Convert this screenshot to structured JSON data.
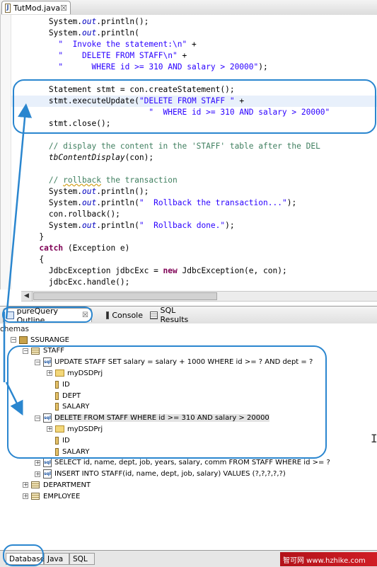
{
  "editor": {
    "tab_label": "TutMod.java",
    "tab_icon": "java-file-icon",
    "close_glyph": "☒"
  },
  "code": [
    {
      "segs": [
        [
          "",
          "        System."
        ],
        [
          "fld",
          "out"
        ],
        [
          "",
          ".println();"
        ]
      ]
    },
    {
      "segs": [
        [
          "",
          "        System."
        ],
        [
          "fld",
          "out"
        ],
        [
          "",
          ".println("
        ]
      ]
    },
    {
      "segs": [
        [
          "",
          "          "
        ],
        [
          "str",
          "\"  Invoke the statement:\\n\""
        ],
        [
          "",
          " +"
        ]
      ]
    },
    {
      "segs": [
        [
          "",
          "          "
        ],
        [
          "str",
          "\"    DELETE FROM STAFF\\n\""
        ],
        [
          "",
          " +"
        ]
      ]
    },
    {
      "segs": [
        [
          "",
          "          "
        ],
        [
          "str",
          "\"      WHERE id >= 310 AND salary > 20000\""
        ],
        [
          "",
          ");"
        ]
      ]
    },
    {
      "segs": [
        [
          "",
          ""
        ]
      ]
    },
    {
      "segs": [
        [
          "",
          "        Statement stmt = con.createStatement();"
        ]
      ]
    },
    {
      "segs": [
        [
          "",
          "        stmt.executeUpdate("
        ],
        [
          "str",
          "\"DELETE FROM STAFF \""
        ],
        [
          "",
          " +"
        ]
      ]
    },
    {
      "segs": [
        [
          "",
          "                             "
        ],
        [
          "str",
          "\"  WHERE id >= 310 AND salary > 20000\""
        ]
      ]
    },
    {
      "segs": [
        [
          "",
          "        stmt.close();"
        ]
      ]
    },
    {
      "segs": [
        [
          "",
          ""
        ]
      ]
    },
    {
      "segs": [
        [
          "cmt",
          "        // display the content in the 'STAFF' table after the DEL"
        ]
      ]
    },
    {
      "segs": [
        [
          "",
          "        "
        ],
        [
          "mth",
          "tbContentDisplay"
        ],
        [
          "",
          "(con);"
        ]
      ]
    },
    {
      "segs": [
        [
          "",
          ""
        ]
      ]
    },
    {
      "segs": [
        [
          "cmt",
          "        // "
        ],
        [
          "cmtsq",
          "rollback"
        ],
        [
          "cmt",
          " the transaction"
        ]
      ]
    },
    {
      "segs": [
        [
          "",
          "        System."
        ],
        [
          "fld",
          "out"
        ],
        [
          "",
          ".println();"
        ]
      ]
    },
    {
      "segs": [
        [
          "",
          "        System."
        ],
        [
          "fld",
          "out"
        ],
        [
          "",
          ".println("
        ],
        [
          "str",
          "\"  Rollback the transaction...\""
        ],
        [
          "",
          ");"
        ]
      ]
    },
    {
      "segs": [
        [
          "",
          "        con.rollback();"
        ]
      ]
    },
    {
      "segs": [
        [
          "",
          "        System."
        ],
        [
          "fld",
          "out"
        ],
        [
          "",
          ".println("
        ],
        [
          "str",
          "\"  Rollback done.\""
        ],
        [
          "",
          ");"
        ]
      ]
    },
    {
      "segs": [
        [
          "",
          "      }"
        ]
      ]
    },
    {
      "segs": [
        [
          "",
          "      "
        ],
        [
          "kw",
          "catch"
        ],
        [
          "",
          " (Exception e)"
        ]
      ]
    },
    {
      "segs": [
        [
          "",
          "      {"
        ]
      ]
    },
    {
      "segs": [
        [
          "",
          "        JdbcException jdbcExc = "
        ],
        [
          "kw",
          "new"
        ],
        [
          "",
          " JdbcException(e, con);"
        ]
      ]
    },
    {
      "segs": [
        [
          "",
          "        jdbcExc.handle();"
        ]
      ]
    },
    {
      "segs": [
        [
          "",
          "      }"
        ]
      ]
    }
  ],
  "views": {
    "tabs": [
      {
        "label": "pureQuery Outline",
        "icon": "outline-icon",
        "active": true,
        "close": "☒"
      },
      {
        "label": "Console",
        "icon": "console-icon",
        "active": false
      },
      {
        "label": "SQL Results",
        "icon": "sql-results-icon",
        "active": false
      }
    ]
  },
  "outline": {
    "header": "chemas",
    "rows": [
      {
        "label": "SSURANGE",
        "depth": 0,
        "exp": "−",
        "icon": "schema"
      },
      {
        "label": "STAFF",
        "depth": 1,
        "exp": "−",
        "icon": "table"
      },
      {
        "label": "UPDATE STAFF   SET salary = salary + 1000   WHERE id >= ? AND dept = ?",
        "depth": 2,
        "exp": "−",
        "icon": "sql"
      },
      {
        "label": "myDSDPrj",
        "depth": 3,
        "exp": "+",
        "icon": "folder"
      },
      {
        "label": "ID",
        "depth": 3,
        "exp": "",
        "icon": "column"
      },
      {
        "label": "DEPT",
        "depth": 3,
        "exp": "",
        "icon": "column"
      },
      {
        "label": "SALARY",
        "depth": 3,
        "exp": "",
        "icon": "column"
      },
      {
        "label": "DELETE FROM STAFF   WHERE id >= 310 AND salary > 20000",
        "depth": 2,
        "exp": "−",
        "icon": "sql",
        "selected": true
      },
      {
        "label": "myDSDPrj",
        "depth": 3,
        "exp": "+",
        "icon": "folder"
      },
      {
        "label": "ID",
        "depth": 3,
        "exp": "",
        "icon": "column"
      },
      {
        "label": "SALARY",
        "depth": 3,
        "exp": "",
        "icon": "column"
      },
      {
        "label": "SELECT id, name, dept, job, years, salary, comm   FROM STAFF   WHERE id >= ?",
        "depth": 2,
        "exp": "+",
        "icon": "sql"
      },
      {
        "label": "INSERT INTO STAFF(id, name, dept, job, salary)   VALUES (?,?,?,?,?)",
        "depth": 2,
        "exp": "+",
        "icon": "sql"
      },
      {
        "label": "DEPARTMENT",
        "depth": 1,
        "exp": "+",
        "icon": "table"
      },
      {
        "label": "EMPLOYEE",
        "depth": 1,
        "exp": "+",
        "icon": "table"
      }
    ]
  },
  "bottom_tabs": [
    {
      "label": "Database",
      "active": true
    },
    {
      "label": "Java",
      "active": false
    },
    {
      "label": "SQL",
      "active": false
    }
  ],
  "watermark": "智可网  www.hzhike.com",
  "annotation_color": "#2a86cf"
}
